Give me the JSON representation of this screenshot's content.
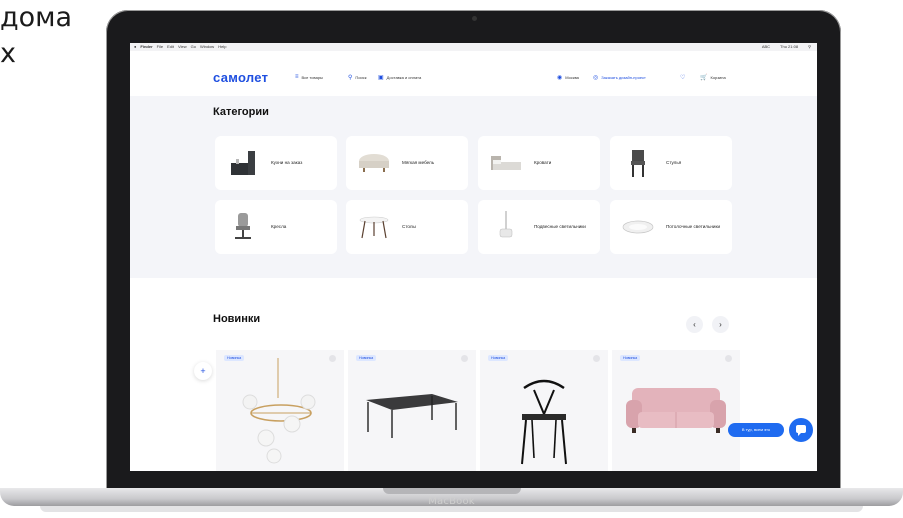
{
  "background_text": {
    "line1": "дома",
    "line2": "х"
  },
  "laptop": {
    "brand": "MacBook"
  },
  "menubar": {
    "apple": "",
    "items": [
      "Finder",
      "File",
      "Edit",
      "View",
      "Go",
      "Window",
      "Help"
    ],
    "right": [
      "ABC",
      "Thu 21:08"
    ]
  },
  "site": {
    "logo": "самолет",
    "nav": {
      "all_goods": "Все товары",
      "search": "Поиск",
      "delivery": "Доставка и оплата",
      "city": "Москва",
      "design": "Заказать дизайн-проект",
      "cart": "Корзина"
    }
  },
  "categories": {
    "title": "Категории",
    "items": [
      {
        "label": "Кухни на заказ",
        "icon": "kitchen-icon"
      },
      {
        "label": "Мягкая мебель",
        "icon": "pouf-icon"
      },
      {
        "label": "Кровати",
        "icon": "bed-icon"
      },
      {
        "label": "Стулья",
        "icon": "chair-icon"
      },
      {
        "label": "Кресла",
        "icon": "office-chair-icon"
      },
      {
        "label": "Столы",
        "icon": "table-icon"
      },
      {
        "label": "Подвесные светильники",
        "icon": "pendant-lamp-icon"
      },
      {
        "label": "Потолочные светильники",
        "icon": "ceiling-lamp-icon"
      }
    ]
  },
  "new_items": {
    "title": "Новинки",
    "prev": "‹",
    "next": "›",
    "products": [
      {
        "tag": "Новинка",
        "image": "chandelier-image"
      },
      {
        "tag": "Новинка",
        "image": "coffee-table-image"
      },
      {
        "tag": "Новинка",
        "image": "wishbone-chair-image"
      },
      {
        "tag": "Новинка",
        "image": "pink-sofa-image"
      }
    ]
  },
  "chat": {
    "pill": "В тур, всем это"
  },
  "colors": {
    "brand": "#1f4fe0",
    "chat": "#1f6bf0",
    "section_bg": "#f4f5f9"
  }
}
